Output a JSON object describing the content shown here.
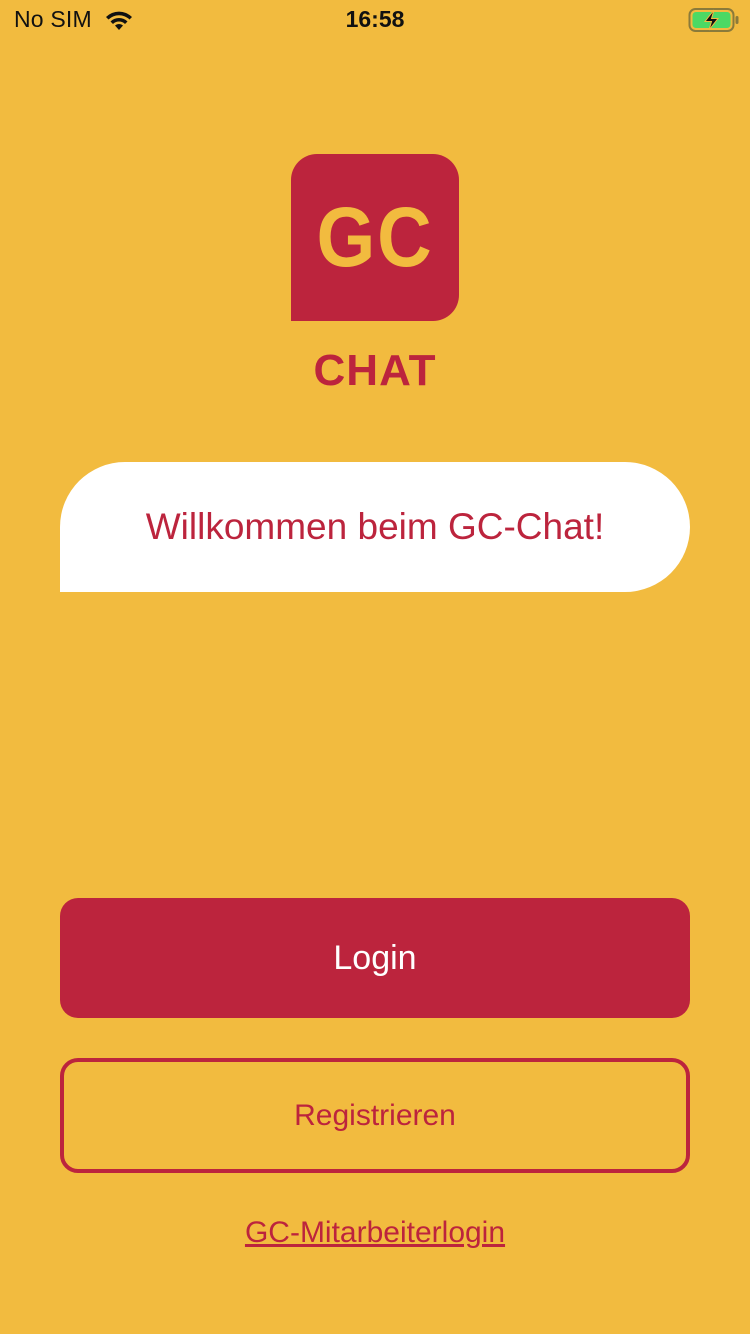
{
  "status_bar": {
    "carrier": "No SIM",
    "time": "16:58"
  },
  "logo": {
    "letters": "GC",
    "word": "CHAT"
  },
  "welcome": {
    "text": "Willkommen beim GC-Chat!"
  },
  "actions": {
    "login_label": "Login",
    "register_label": "Registrieren",
    "staff_login_label": "GC-Mitarbeiterlogin"
  },
  "colors": {
    "background": "#F2BB3F",
    "brand_red": "#BC243D",
    "white": "#FFFFFF"
  },
  "icons": {
    "wifi": "wifi-icon",
    "battery": "battery-charging-icon"
  }
}
